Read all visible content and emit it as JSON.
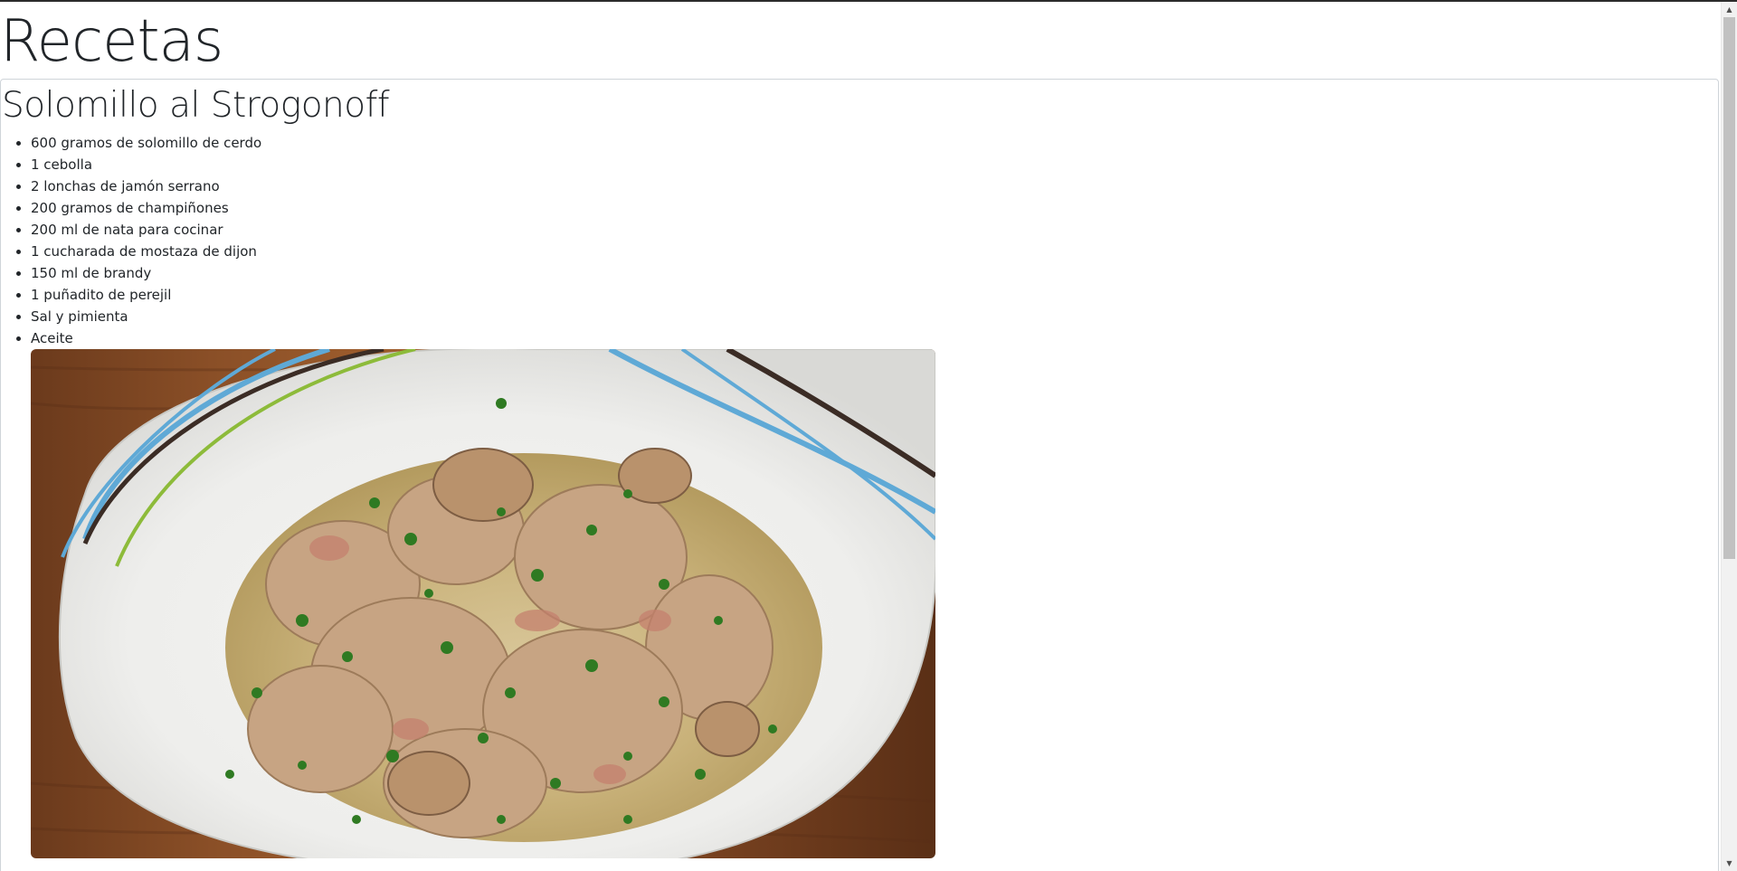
{
  "page": {
    "title": "Recetas"
  },
  "recipe": {
    "title": "Solomillo al Strogonoff",
    "ingredients": [
      "600 gramos de solomillo de cerdo",
      "1 cebolla",
      "2 lonchas de jamón serrano",
      "200 gramos de champiñones",
      "200 ml de nata para cocinar",
      "1 cucharada de mostaza de dijon",
      "150 ml de brandy",
      "1 puñadito de perejil",
      "Sal y pimienta",
      "Aceite"
    ],
    "photo_icon": "food-photo"
  },
  "scrollbar": {
    "up_icon": "▲",
    "down_icon": "▼"
  },
  "colors": {
    "text": "#212529",
    "card_border": "#cfd4d9",
    "scrollbar_track": "#f1f1f1",
    "scrollbar_thumb": "#c1c1c1"
  }
}
